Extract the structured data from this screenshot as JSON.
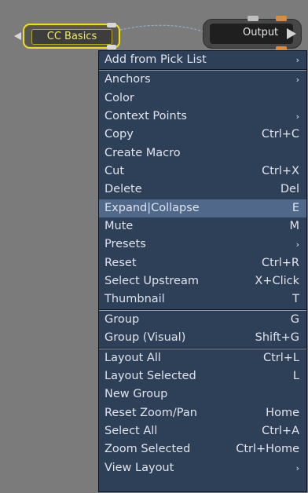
{
  "nodes": {
    "basics": {
      "label": "CC Basics"
    },
    "output": {
      "label": "Output"
    }
  },
  "menu": {
    "top_item": {
      "label": "Add from Pick List",
      "icon": "chevron-right-icon"
    },
    "group1": [
      {
        "label": "Anchors",
        "shortcut": "",
        "submenu": true
      },
      {
        "label": "Color",
        "shortcut": "",
        "submenu": false
      },
      {
        "label": "Context Points",
        "shortcut": "",
        "submenu": true
      },
      {
        "label": "Copy",
        "shortcut": "Ctrl+C",
        "submenu": false
      },
      {
        "label": "Create Macro",
        "shortcut": "",
        "submenu": false
      },
      {
        "label": "Cut",
        "shortcut": "Ctrl+X",
        "submenu": false
      },
      {
        "label": "Delete",
        "shortcut": "Del",
        "submenu": false
      },
      {
        "label": "Expand|Collapse",
        "shortcut": "E",
        "submenu": false,
        "highlighted": true
      },
      {
        "label": "Mute",
        "shortcut": "M",
        "submenu": false
      },
      {
        "label": "Presets",
        "shortcut": "",
        "submenu": true
      },
      {
        "label": "Reset",
        "shortcut": "Ctrl+R",
        "submenu": false
      },
      {
        "label": "Select Upstream",
        "shortcut": "X+Click",
        "submenu": false
      },
      {
        "label": "Thumbnail",
        "shortcut": "T",
        "submenu": false
      }
    ],
    "group2": [
      {
        "label": "Group",
        "shortcut": "G",
        "submenu": false
      },
      {
        "label": "Group (Visual)",
        "shortcut": "Shift+G",
        "submenu": false
      }
    ],
    "group3": [
      {
        "label": "Layout All",
        "shortcut": "Ctrl+L",
        "submenu": false
      },
      {
        "label": "Layout Selected",
        "shortcut": "L",
        "submenu": false
      },
      {
        "label": "New Group",
        "shortcut": "",
        "submenu": false
      },
      {
        "label": "Reset Zoom/Pan",
        "shortcut": "Home",
        "submenu": false
      },
      {
        "label": "Select All",
        "shortcut": "Ctrl+A",
        "submenu": false
      },
      {
        "label": "Zoom Selected",
        "shortcut": "Ctrl+Home",
        "submenu": false
      },
      {
        "label": "View Layout",
        "shortcut": "",
        "submenu": true
      }
    ]
  },
  "colors": {
    "canvas": "#7b7b7b",
    "menu_bg": "#2e3f58",
    "menu_highlight": "#506889",
    "node_select": "#e9dc2e",
    "socket_orange": "#d98a44"
  },
  "icons": {
    "submenu": "chevron-right-icon",
    "output_play": "play-icon",
    "input_arrow": "input-arrow-icon"
  }
}
